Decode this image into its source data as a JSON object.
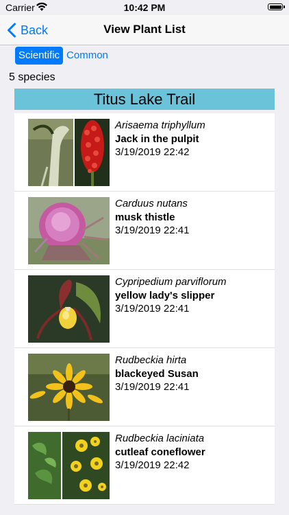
{
  "status_bar": {
    "carrier": "Carrier",
    "time": "10:42 PM"
  },
  "nav": {
    "back_label": "Back",
    "title": "View Plant List"
  },
  "segmented": {
    "options": [
      "Scientific",
      "Common"
    ],
    "selected": "Scientific"
  },
  "species_count": "5 species",
  "section_title": "Titus Lake Trail",
  "plants": [
    {
      "scientific": "Arisaema triphyllum",
      "common": "Jack in the pulpit",
      "date": "3/19/2019 22:42"
    },
    {
      "scientific": "Carduus nutans",
      "common": "musk thistle",
      "date": "3/19/2019 22:41"
    },
    {
      "scientific": "Cypripedium parviflorum",
      "common": "yellow lady's slipper",
      "date": "3/19/2019 22:41"
    },
    {
      "scientific": "Rudbeckia hirta",
      "common": "blackeyed Susan",
      "date": "3/19/2019 22:41"
    },
    {
      "scientific": "Rudbeckia laciniata",
      "common": "cutleaf coneflower",
      "date": "3/19/2019 22:42"
    }
  ],
  "colors": {
    "accent": "#007aff",
    "section_header": "#6ac3d8",
    "background": "#efeff4"
  }
}
